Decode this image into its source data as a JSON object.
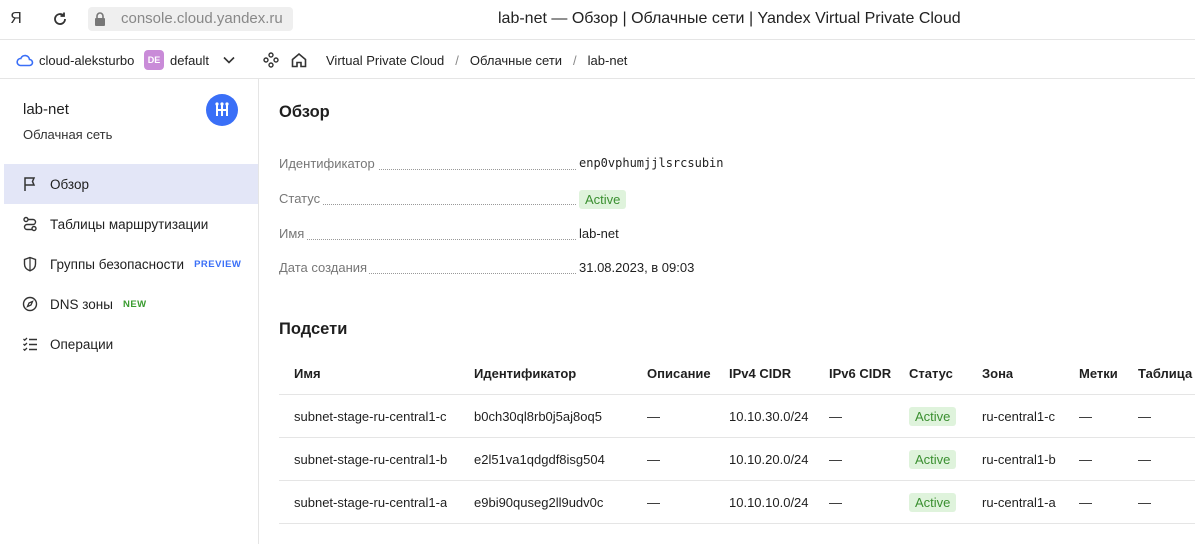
{
  "browser": {
    "logo": "Я",
    "url": "console.cloud.yandex.ru",
    "tab_title": "lab-net — Обзор | Облачные сети | Yandex Virtual Private Cloud"
  },
  "header": {
    "cloud_name": "cloud-aleksturbo",
    "folder_badge": "DE",
    "folder_name": "default",
    "breadcrumbs": [
      "Virtual Private Cloud",
      "Облачные сети",
      "lab-net"
    ],
    "separator": "/"
  },
  "sidebar": {
    "title": "lab-net",
    "subtitle": "Облачная сеть",
    "items": [
      {
        "label": "Обзор",
        "badge": "",
        "icon": "flag-icon"
      },
      {
        "label": "Таблицы маршрутизации",
        "badge": "",
        "icon": "route-icon"
      },
      {
        "label": "Группы безопасности",
        "badge": "PREVIEW",
        "icon": "shield-icon"
      },
      {
        "label": "DNS зоны",
        "badge": "NEW",
        "icon": "compass-icon"
      },
      {
        "label": "Операции",
        "badge": "",
        "icon": "list-check-icon"
      }
    ]
  },
  "overview": {
    "heading": "Обзор",
    "props": [
      {
        "label": "Идентификатор",
        "value": "enp0vphumjjlsrcsubin"
      },
      {
        "label": "Статус",
        "value": "Active"
      },
      {
        "label": "Имя",
        "value": "lab-net"
      },
      {
        "label": "Дата создания",
        "value": "31.08.2023, в 09:03"
      }
    ]
  },
  "subnets": {
    "heading": "Подсети",
    "columns": [
      "Имя",
      "Идентификатор",
      "Описание",
      "IPv4 CIDR",
      "IPv6 CIDR",
      "Статус",
      "Зона",
      "Метки",
      "Таблица м"
    ],
    "rows": [
      [
        "subnet-stage-ru-central1-c",
        "b0ch30ql8rb0j5aj8oq5",
        "—",
        "10.10.30.0/24",
        "—",
        "Active",
        "ru-central1-c",
        "—",
        "—"
      ],
      [
        "subnet-stage-ru-central1-b",
        "e2l51va1qdgdf8isg504",
        "—",
        "10.10.20.0/24",
        "—",
        "Active",
        "ru-central1-b",
        "—",
        "—"
      ],
      [
        "subnet-stage-ru-central1-a",
        "e9bi90quseg2ll9udv0c",
        "—",
        "10.10.10.0/24",
        "—",
        "Active",
        "ru-central1-a",
        "—",
        "—"
      ]
    ]
  },
  "colors": {
    "accent": "#3a6ff7",
    "active_nav": "#e3e6f7",
    "status_bg": "#dff3dc",
    "status_text": "#3a8f30",
    "preview_badge": "#3a6ff7",
    "new_badge": "#3a9c30",
    "folder_badge": "#c98bd8"
  }
}
